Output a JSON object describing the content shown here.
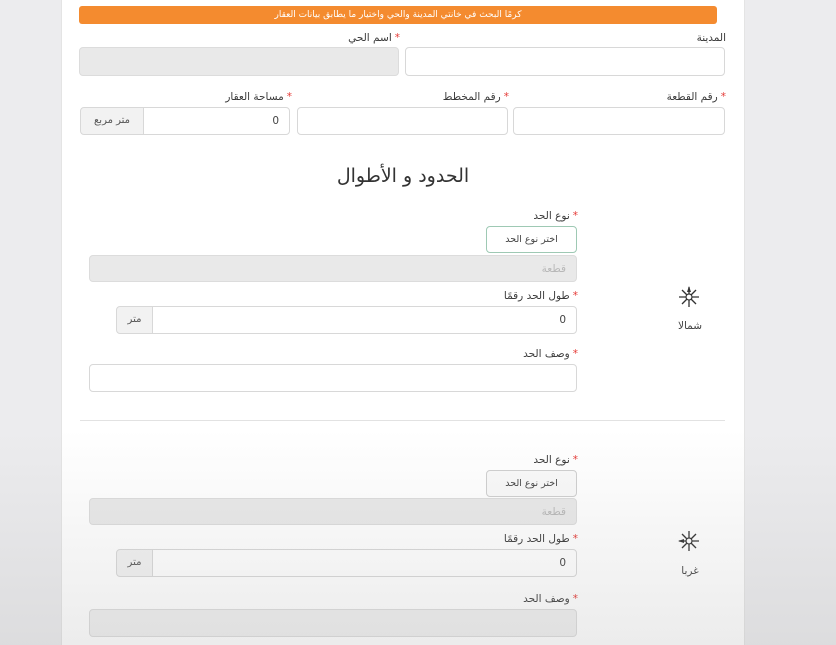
{
  "banner": "كرمًا البحث في خانتي المدينة والحي واختيار ما يطابق بيانات العقار",
  "city": {
    "label": "المدينة",
    "value": ""
  },
  "district": {
    "label": "اسم الحي",
    "value": ""
  },
  "plot": {
    "label": "رقم القطعة",
    "value": ""
  },
  "plan": {
    "label": "رقم المخطط",
    "value": ""
  },
  "area": {
    "label": "مساحة العقار",
    "value": "0",
    "unit": "متر مربع"
  },
  "section_title": "الحدود و الأطوال",
  "borders": [
    {
      "direction": "شمالا",
      "icon": "compass-north-icon",
      "type_label": "نوع الحد",
      "type_button": "اختر نوع الحد",
      "type_value": "قطعة",
      "length_label": "طول الحد رقمًا",
      "length_value": "0",
      "length_unit": "متر",
      "desc_label": "وصف الحد",
      "desc_value": ""
    },
    {
      "direction": "غربا",
      "icon": "compass-west-icon",
      "type_label": "نوع الحد",
      "type_button": "اختر نوع الحد",
      "type_value": "قطعة",
      "length_label": "طول الحد رقمًا",
      "length_value": "0",
      "length_unit": "متر",
      "desc_label": "وصف الحد",
      "desc_value": ""
    }
  ],
  "colors": {
    "banner": "#f48b2f",
    "required": "#e53935",
    "select_border": "#9ec9b4"
  }
}
